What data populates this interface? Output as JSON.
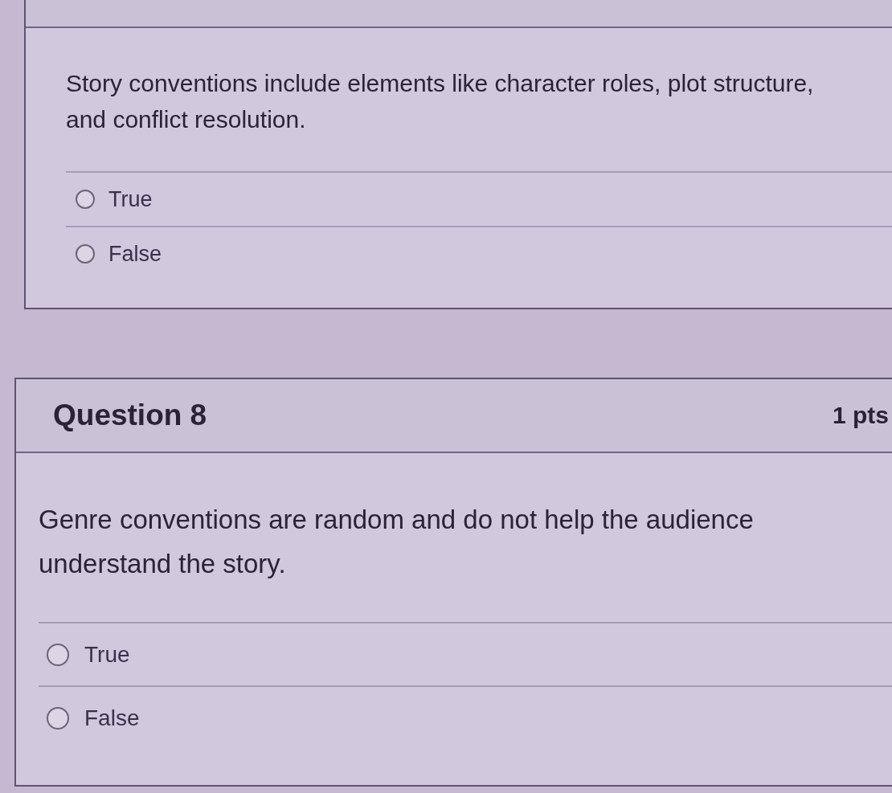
{
  "questions": [
    {
      "text": "Story conventions include elements like character roles, plot structure, and conflict resolution.",
      "options": [
        {
          "label": "True",
          "selected": false
        },
        {
          "label": "False",
          "selected": false
        }
      ]
    },
    {
      "title": "Question 8",
      "points": "1 pts",
      "text": "Genre conventions are random and do not help the audience understand the story.",
      "options": [
        {
          "label": "True",
          "selected": false
        },
        {
          "label": "False",
          "selected": false
        }
      ]
    }
  ]
}
